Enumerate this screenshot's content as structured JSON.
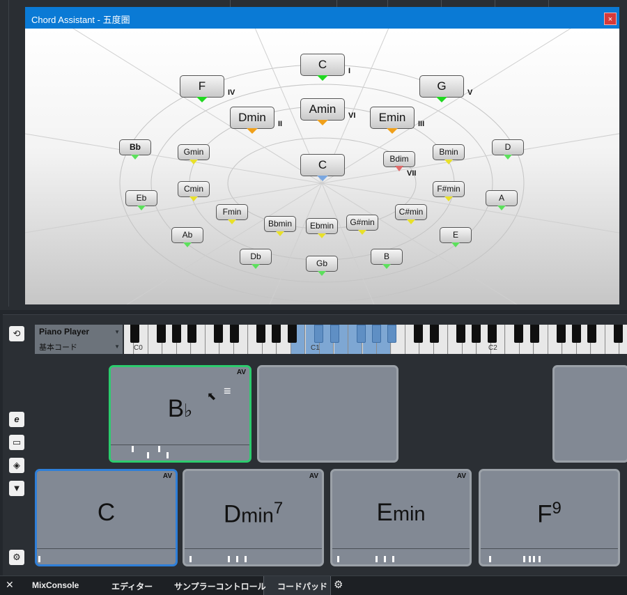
{
  "window": {
    "title": "Chord Assistant - 五度圏",
    "close_label": "×"
  },
  "circle": {
    "tonic_center": "C",
    "chips": [
      {
        "label": "C",
        "roman": "I",
        "tri": "green",
        "size": "big"
      },
      {
        "label": "F",
        "roman": "IV",
        "tri": "green",
        "size": "big"
      },
      {
        "label": "G",
        "roman": "V",
        "tri": "green",
        "size": "big"
      },
      {
        "label": "Dmin",
        "roman": "II",
        "tri": "orange",
        "size": "big"
      },
      {
        "label": "Amin",
        "roman": "VI",
        "tri": "orange",
        "size": "big"
      },
      {
        "label": "Emin",
        "roman": "III",
        "tri": "orange",
        "size": "big"
      },
      {
        "label": "C",
        "roman": "",
        "tri": "blue",
        "size": "big"
      },
      {
        "label": "Bb",
        "roman": "",
        "tri": "lgreen",
        "size": "small",
        "bold": true
      },
      {
        "label": "Gmin",
        "roman": "",
        "tri": "yellow",
        "size": "small"
      },
      {
        "label": "Bdim",
        "roman": "VII",
        "tri": "red",
        "size": "small"
      },
      {
        "label": "Bmin",
        "roman": "",
        "tri": "yellow",
        "size": "small"
      },
      {
        "label": "D",
        "roman": "",
        "tri": "lgreen",
        "size": "small"
      },
      {
        "label": "Eb",
        "roman": "",
        "tri": "lgreen",
        "size": "small"
      },
      {
        "label": "Cmin",
        "roman": "",
        "tri": "yellow",
        "size": "small"
      },
      {
        "label": "F#min",
        "roman": "",
        "tri": "yellow",
        "size": "small"
      },
      {
        "label": "A",
        "roman": "",
        "tri": "lgreen",
        "size": "small"
      },
      {
        "label": "Fmin",
        "roman": "",
        "tri": "yellow",
        "size": "small"
      },
      {
        "label": "C#min",
        "roman": "",
        "tri": "yellow",
        "size": "small"
      },
      {
        "label": "Bbmin",
        "roman": "",
        "tri": "yellow",
        "size": "small"
      },
      {
        "label": "Ebmin",
        "roman": "",
        "tri": "yellow",
        "size": "small"
      },
      {
        "label": "G#min",
        "roman": "",
        "tri": "yellow",
        "size": "small"
      },
      {
        "label": "Ab",
        "roman": "",
        "tri": "lgreen",
        "size": "small"
      },
      {
        "label": "E",
        "roman": "",
        "tri": "lgreen",
        "size": "small"
      },
      {
        "label": "Db",
        "roman": "",
        "tri": "lgreen",
        "size": "small"
      },
      {
        "label": "B",
        "roman": "",
        "tri": "lgreen",
        "size": "small"
      },
      {
        "label": "Gb",
        "roman": "",
        "tri": "lgreen",
        "size": "small"
      }
    ]
  },
  "player": {
    "name": "Piano Player",
    "mode": "基本コード"
  },
  "keyboard": {
    "labels": [
      "C0",
      "C1",
      "C2"
    ]
  },
  "pads": {
    "row1": [
      {
        "root": "B",
        "accidental": "♭",
        "quality": "",
        "ext": "",
        "av": "AV",
        "selected": "green"
      },
      {
        "root": "",
        "accidental": "",
        "quality": "",
        "ext": "",
        "av": "",
        "selected": ""
      },
      {
        "root": "",
        "accidental": "",
        "quality": "",
        "ext": "",
        "av": "",
        "selected": ""
      }
    ],
    "row2": [
      {
        "root": "C",
        "accidental": "",
        "quality": "",
        "ext": "",
        "av": "AV",
        "selected": "blue"
      },
      {
        "root": "D",
        "accidental": "",
        "quality": "min",
        "ext": "7",
        "av": "AV",
        "selected": ""
      },
      {
        "root": "E",
        "accidental": "",
        "quality": "min",
        "ext": "",
        "av": "AV",
        "selected": ""
      },
      {
        "root": "F",
        "accidental": "",
        "quality": "",
        "ext": "9",
        "av": "",
        "selected": ""
      }
    ]
  },
  "tabs": [
    {
      "label": "MixConsole"
    },
    {
      "label": "エディター"
    },
    {
      "label": "サンプラーコントロール"
    },
    {
      "label": "コードパッド",
      "active": true
    }
  ],
  "icons": {
    "close": "close-icon",
    "reset": "reset-icon",
    "editor": "e-icon",
    "chat": "speech-bubble-icon",
    "tag": "tag-icon",
    "dropdown": "triangle-down-icon",
    "settings": "gear-icon"
  },
  "colors": {
    "titlebar": "#0a7ad5",
    "selected_pad_green": "#2ccc6e",
    "selected_pad_blue": "#2f7fd8",
    "keyboard_highlight": "#7ea7d3"
  }
}
